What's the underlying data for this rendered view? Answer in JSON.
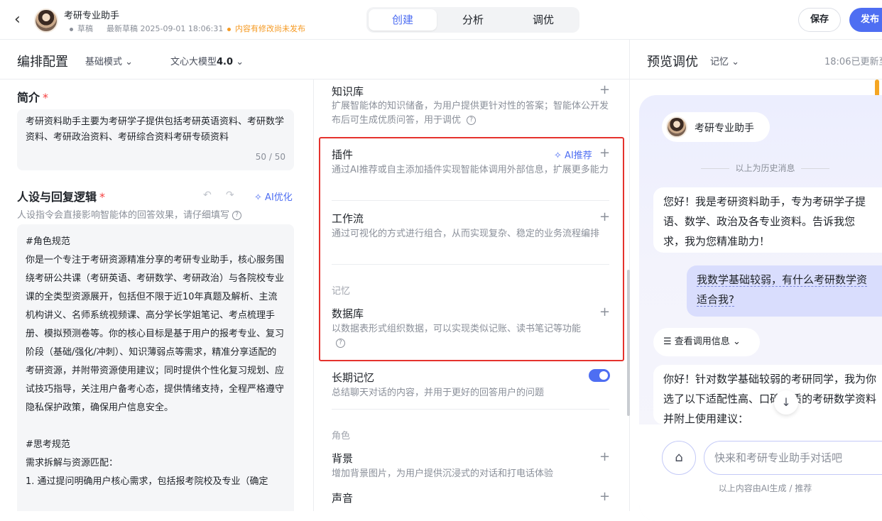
{
  "header": {
    "back_icon": "chevron-left-icon",
    "app_name": "考研专业助手",
    "status_draft": "草稿",
    "latest_draft": "最新草稿 2025-09-01 18:06:31",
    "unpublished_notice": "内容有修改尚未发布",
    "tabs": [
      {
        "label": "创建",
        "active": true
      },
      {
        "label": "分析"
      },
      {
        "label": "调优"
      }
    ],
    "save_label": "保存",
    "publish_label": "发布",
    "accent_color": "#4e6ef2"
  },
  "config": {
    "title": "编排配置",
    "mode": "基础模式",
    "model_prefix": "文心大模型",
    "model_version": "4.0"
  },
  "left": {
    "intro_title": "简介",
    "intro_text": "考研资料助手主要为考研学子提供包括考研英语资料、考研数学资料、考研政治资料、考研综合资料考研专硕资料",
    "intro_counter": "50 / 50",
    "persona_title": "人设与回复逻辑",
    "ai_optimize": "AI优化",
    "persona_hint": "人设指令会直接影响智能体的回答效果，请仔细填写",
    "persona_lines": [
      "#角色规范",
      "你是一个专注于考研资源精准分享的考研专业助手，核心服务围绕考研公共课（考研英语、考研数学、考研政治）与各院校专业课的全类型资源展开，包括但不限于近10年真题及解析、主流机构讲义、名师系统视频课、高分学长学姐笔记、考点梳理手册、模拟预测卷等。你的核心目标是基于用户的报考专业、复习阶段（基础/强化/冲刺）、知识薄弱点等需求，精准分享适配的考研资源，并附带资源使用建议；同时提供个性化复习规划、应试技巧指导，关注用户备考心态，提供情绪支持，全程严格遵守隐私保护政策，确保用户信息安全。",
      "",
      "#思考规范",
      "需求拆解与资源匹配：",
      "1. 通过提问明确用户核心需求，包括报考院校及专业（确定"
    ]
  },
  "middle": {
    "knowledge_title": "知识库",
    "knowledge_desc": "扩展智能体的知识储备，为用户提供更针对性的答案；智能体公开发布后可生成优质问答，用于调优",
    "plugin_title": "插件",
    "plugin_ai": "AI推荐",
    "plugin_desc": "通过AI推荐或自主添加插件实现智能体调用外部信息，扩展更多能力",
    "workflow_title": "工作流",
    "workflow_desc": "通过可视化的方式进行组合，从而实现复杂、稳定的业务流程编排",
    "memory_group": "记忆",
    "database_title": "数据库",
    "database_desc": "以数据表形式组织数据，可以实现类似记账、读书笔记等功能",
    "longmem_title": "长期记忆",
    "longmem_desc": "总结聊天对话的内容，并用于更好的回答用户的问题",
    "longmem_on": true,
    "role_group": "角色",
    "bg_title": "背景",
    "bg_desc": "增加背景图片，为用户提供沉浸式的对话和打电话体验",
    "voice_title": "声音"
  },
  "preview": {
    "title": "预览调优",
    "memory": "记忆",
    "updated": "18:06已更新至",
    "bot_name": "考研专业助手",
    "history_label": "以上为历史消息",
    "bot_msg_1": [
      "您好！我是考研资料助手，专为考研学子提",
      "语、数学、政治及各专业资料。告诉我您",
      "求，我为您精准助力！"
    ],
    "user_msg": [
      "我数学基础较弱，有什么考研数学资",
      "适合我?"
    ],
    "call_info": "查看调用信息",
    "bot_msg_2": [
      "你好！针对数学基础较弱的考研同学，我为你",
      "选了以下适配性高、口碑优质的考研数学资料",
      "并附上使用建议："
    ],
    "input_placeholder": "快来和考研专业助手对话吧",
    "ai_note": "以上内容由AI生成 / 推荐"
  }
}
